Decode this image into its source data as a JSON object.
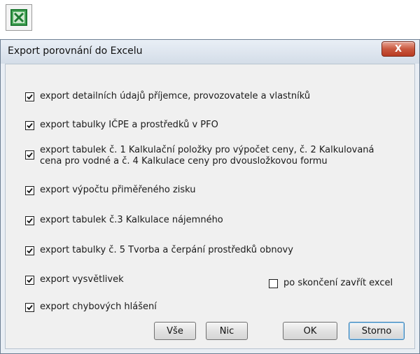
{
  "dialog": {
    "title": "Export porovnání do Excelu",
    "close_label": "X"
  },
  "options": [
    {
      "label": "export detailních údajů příjemce, provozovatele a vlastníků",
      "checked": true
    },
    {
      "label": "export tabulky IČPE a prostředků v PFO",
      "checked": true
    },
    {
      "label": "export tabulek č. 1 Kalkulační položky pro výpočet ceny, č. 2 Kalkulovaná cena pro vodné a č. 4 Kalkulace ceny pro dvousložkovou formu",
      "checked": true
    },
    {
      "label": "export výpočtu přiměřeného zisku",
      "checked": true
    },
    {
      "label": "export tabulek č.3 Kalkulace nájemného",
      "checked": true
    },
    {
      "label": "export tabulky č. 5 Tvorba a čerpání prostředků obnovy",
      "checked": true
    },
    {
      "label": "export vysvětlivek",
      "checked": true
    },
    {
      "label": "export chybových hlášení",
      "checked": true
    }
  ],
  "close_excel": {
    "label": "po skončení zavřít excel",
    "checked": false
  },
  "buttons": {
    "all": "Vše",
    "none": "Nic",
    "ok": "OK",
    "cancel": "Storno"
  },
  "icons": {
    "app": "excel-icon",
    "check": "check-icon"
  },
  "colors": {
    "excel_green": "#1e7a32",
    "close_red": "#c9583f"
  }
}
